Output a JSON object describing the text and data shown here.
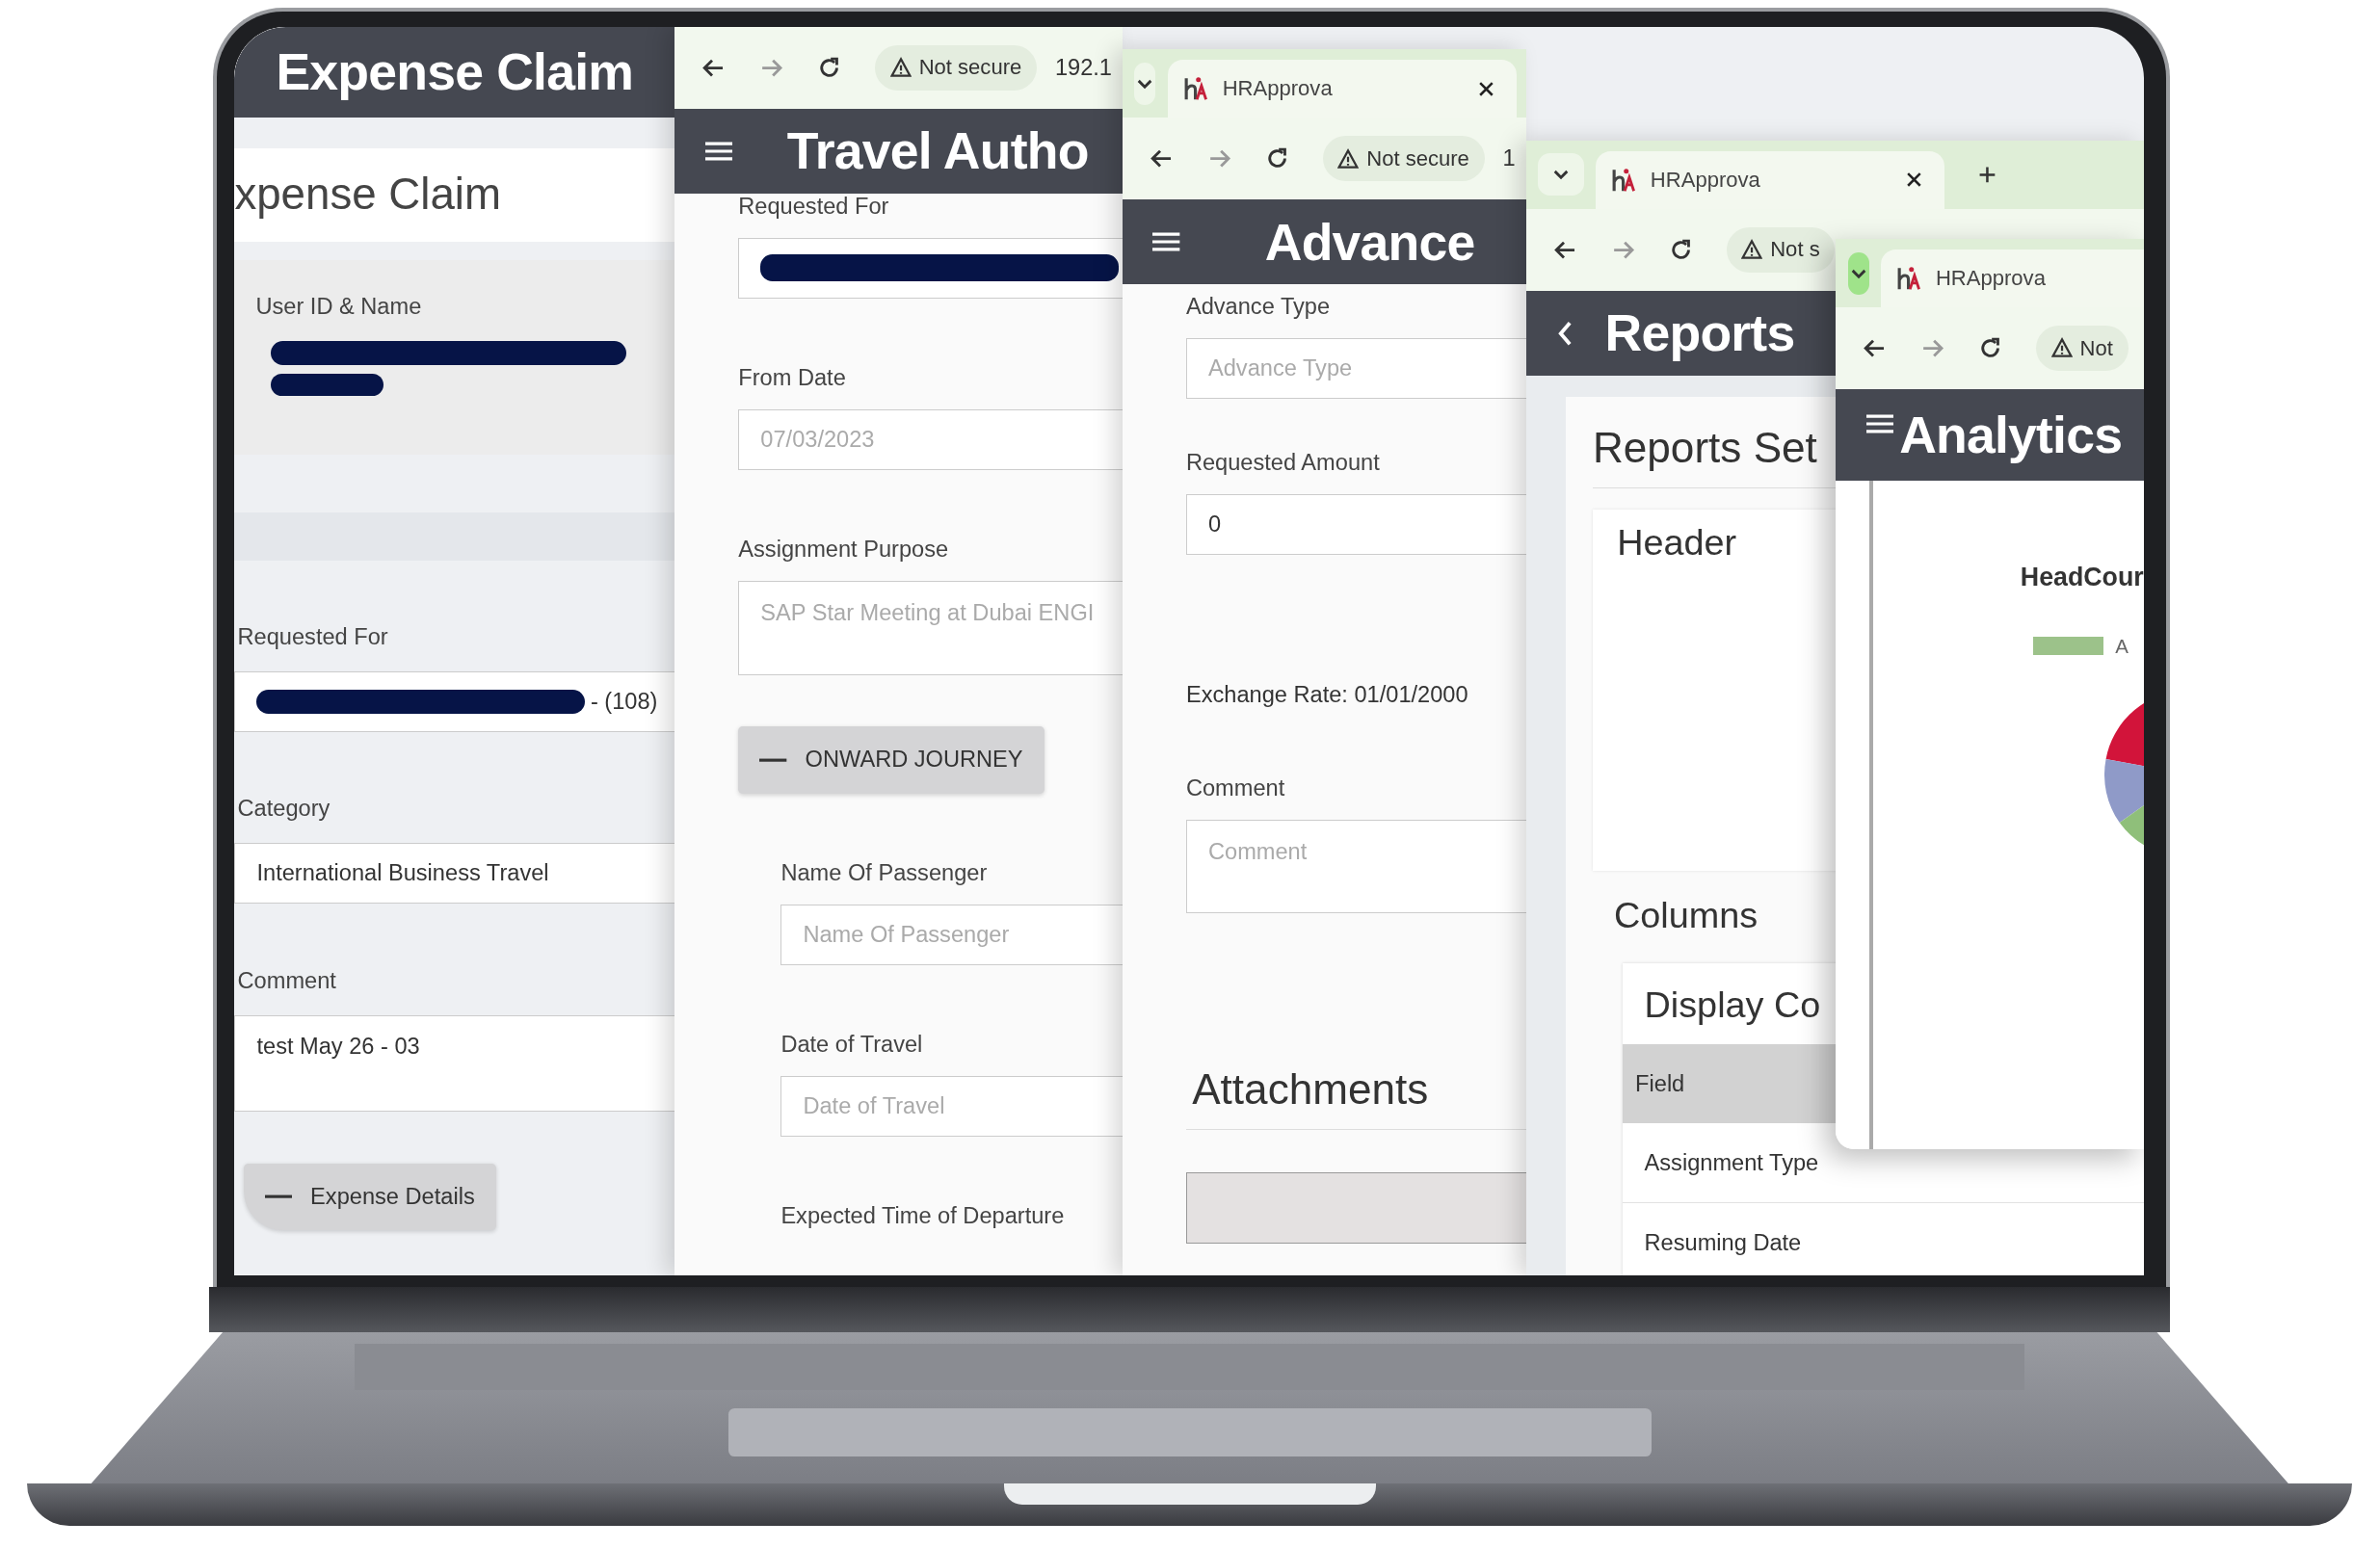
{
  "windows": [
    {
      "kind": "expense",
      "header": {
        "title": "Expense Claim"
      },
      "body": [
        {
          "kind": "page-heading",
          "text": "xpense Claim"
        },
        {
          "kind": "panel",
          "children": [
            {
              "kind": "label",
              "text": "User ID & Name"
            },
            {
              "kind": "redacted-text",
              "redacted": true
            }
          ]
        },
        {
          "kind": "spacer"
        },
        {
          "kind": "label",
          "text": "Requested For"
        },
        {
          "kind": "field",
          "redacted": true,
          "value": "- (108)"
        },
        {
          "kind": "label",
          "text": "Category"
        },
        {
          "kind": "field",
          "value": "International Business Travel"
        },
        {
          "kind": "label",
          "text": "Comment"
        },
        {
          "kind": "textarea",
          "value": "test May 26 - 03"
        },
        {
          "kind": "toggle-button",
          "text": "Expense Details",
          "expanded": true
        }
      ]
    },
    {
      "kind": "travel",
      "browser": {
        "security": "Not secure",
        "address": "192.1"
      },
      "header": {
        "menu_button": true,
        "title": "Travel Autho"
      },
      "body": [
        {
          "kind": "label",
          "text": "Requested For"
        },
        {
          "kind": "field",
          "redacted": true
        },
        {
          "kind": "label",
          "text": "From Date"
        },
        {
          "kind": "field",
          "value": "07/03/2023",
          "disabled": true
        },
        {
          "kind": "label",
          "text": "Assignment Purpose"
        },
        {
          "kind": "textarea",
          "value": "SAP Star Meeting at Dubai ENGI",
          "disabled": true
        },
        {
          "kind": "toggle-button",
          "text": "ONWARD JOURNEY",
          "expanded": true,
          "children": [
            {
              "kind": "label",
              "text": "Name Of Passenger"
            },
            {
              "kind": "field",
              "placeholder": "Name Of Passenger"
            },
            {
              "kind": "label",
              "text": "Date of Travel"
            },
            {
              "kind": "field",
              "placeholder": "Date of Travel"
            },
            {
              "kind": "label",
              "text": "Expected Time of Departure"
            }
          ]
        }
      ]
    },
    {
      "kind": "advance",
      "browser": {
        "tab_title": "HRApprova",
        "tab_menu_active": false,
        "security": "Not secure",
        "address": "1"
      },
      "header": {
        "menu_button": true,
        "title": "Advance"
      },
      "body": [
        {
          "kind": "label",
          "text": "Advance Type"
        },
        {
          "kind": "field",
          "placeholder": "Advance Type"
        },
        {
          "kind": "label",
          "text": "Requested Amount"
        },
        {
          "kind": "field",
          "value": "0"
        },
        {
          "kind": "text",
          "text": "Exchange Rate: 01/01/2000"
        },
        {
          "kind": "label",
          "text": "Comment"
        },
        {
          "kind": "textarea",
          "placeholder": "Comment"
        },
        {
          "kind": "section-heading",
          "text": "Attachments"
        },
        {
          "kind": "dropzone"
        }
      ]
    },
    {
      "kind": "reports",
      "browser": {
        "tab_title": "HRApprova",
        "tab_menu_active": false,
        "security": "Not s"
      },
      "header": {
        "back_button": true,
        "title": "Reports"
      },
      "body": [
        {
          "kind": "card",
          "title": "Reports Set",
          "children": [
            {
              "kind": "subcard",
              "title": "Header"
            },
            {
              "kind": "section-title",
              "text": "Columns"
            },
            {
              "kind": "table-card",
              "title": "Display Co",
              "columns": [
                "Field"
              ],
              "rows": [
                [
                  "Assignment Type"
                ],
                [
                  "Resuming Date"
                ]
              ]
            }
          ]
        }
      ]
    },
    {
      "kind": "analytics",
      "browser": {
        "tab_title": "HRApprova",
        "tab_menu_active": true,
        "security": "Not"
      },
      "header": {
        "menu_button": true,
        "title": "Analytics"
      },
      "body": [
        {
          "kind": "chart",
          "title": "HeadCour",
          "legend": [
            {
              "label": "A",
              "color": "#9cc28a"
            }
          ]
        }
      ]
    }
  ]
}
